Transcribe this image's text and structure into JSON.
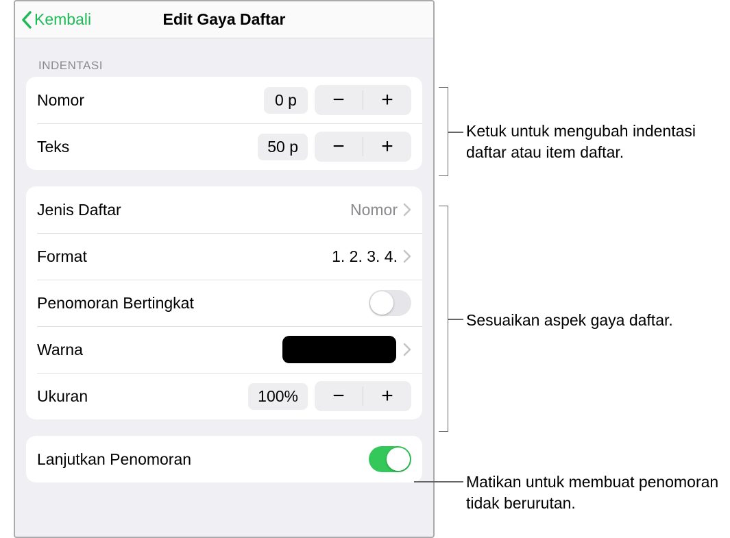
{
  "header": {
    "back_label": "Kembali",
    "title": "Edit Gaya Daftar"
  },
  "sections": {
    "indentasi_label": "Indentasi",
    "indent": {
      "nomor_label": "Nomor",
      "nomor_value": "0 p",
      "teks_label": "Teks",
      "teks_value": "50 p"
    },
    "style": {
      "jenis_label": "Jenis Daftar",
      "jenis_value": "Nomor",
      "format_label": "Format",
      "format_value": "1. 2. 3. 4.",
      "tiered_label": "Penomoran Bertingkat",
      "tiered_on": false,
      "warna_label": "Warna",
      "warna_value": "#000000",
      "ukuran_label": "Ukuran",
      "ukuran_value": "100%"
    },
    "continue": {
      "label": "Lanjutkan Penomoran",
      "on": true
    }
  },
  "callouts": {
    "c1": "Ketuk untuk mengubah indentasi daftar atau item daftar.",
    "c2": "Sesuaikan aspek gaya daftar.",
    "c3": "Matikan untuk membuat penomoran tidak berurutan."
  },
  "glyphs": {
    "minus": "−",
    "plus": "+"
  }
}
